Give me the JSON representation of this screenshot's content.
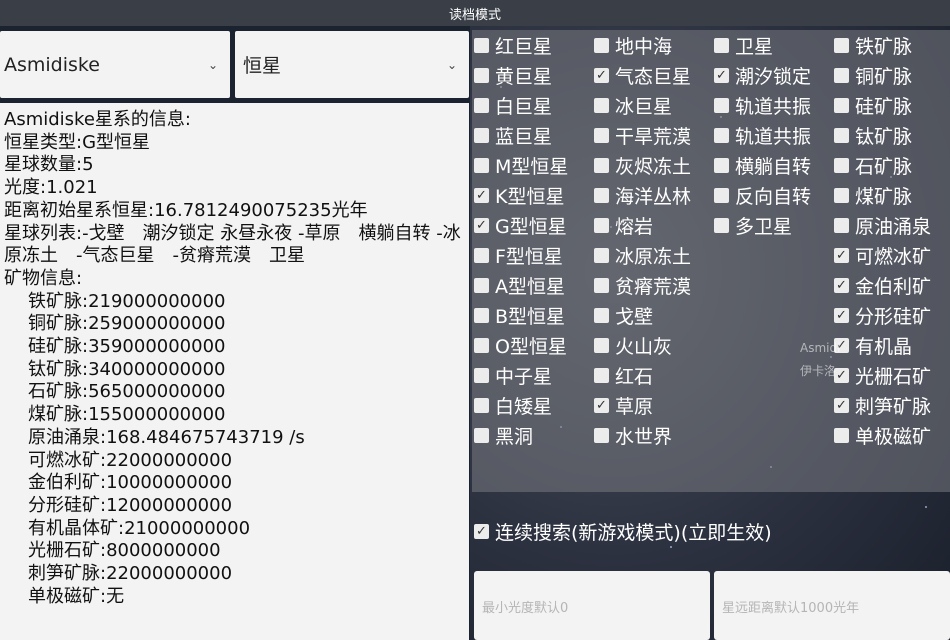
{
  "window": {
    "title": "读档模式"
  },
  "dropdowns": {
    "system": "Asmidiske",
    "star_type": "恒星"
  },
  "info": {
    "lines": [
      "Asmidiske星系的信息:",
      "恒星类型:G型恒星",
      "星球数量:5",
      "光度:1.021",
      "距离初始星系恒星:16.7812490075235光年",
      "星球列表:-戈壁　潮汐锁定 永昼永夜 -草原　横躺自转 -冰原冻土　-气态巨星　-贫瘠荒漠　卫星",
      "矿物信息:"
    ],
    "minerals": [
      "铁矿脉:219000000000",
      "铜矿脉:259000000000",
      "硅矿脉:359000000000",
      "钛矿脉:340000000000",
      "石矿脉:565000000000",
      "煤矿脉:155000000000",
      "原油涌泉:168.484675743719 /s",
      "可燃冰矿:22000000000",
      "金伯利矿:10000000000",
      "分形硅矿:12000000000",
      "有机晶体矿:21000000000",
      "光栅石矿:8000000000",
      "刺笋矿脉:22000000000",
      "单极磁矿:无"
    ]
  },
  "options": {
    "col1": [
      {
        "label": "红巨星",
        "checked": false
      },
      {
        "label": "黄巨星",
        "checked": false
      },
      {
        "label": "白巨星",
        "checked": false
      },
      {
        "label": "蓝巨星",
        "checked": false
      },
      {
        "label": "M型恒星",
        "checked": false
      },
      {
        "label": "K型恒星",
        "checked": true
      },
      {
        "label": "G型恒星",
        "checked": true
      },
      {
        "label": "F型恒星",
        "checked": false
      },
      {
        "label": "A型恒星",
        "checked": false
      },
      {
        "label": "B型恒星",
        "checked": false
      },
      {
        "label": "O型恒星",
        "checked": false
      },
      {
        "label": "中子星",
        "checked": false
      },
      {
        "label": "白矮星",
        "checked": false
      },
      {
        "label": "黑洞",
        "checked": false
      }
    ],
    "col2": [
      {
        "label": "地中海",
        "checked": false
      },
      {
        "label": "气态巨星",
        "checked": true
      },
      {
        "label": "冰巨星",
        "checked": false
      },
      {
        "label": "干旱荒漠",
        "checked": false
      },
      {
        "label": "灰烬冻土",
        "checked": false
      },
      {
        "label": "海洋丛林",
        "checked": false
      },
      {
        "label": "熔岩",
        "checked": false
      },
      {
        "label": "冰原冻土",
        "checked": false
      },
      {
        "label": "贫瘠荒漠",
        "checked": false
      },
      {
        "label": "戈壁",
        "checked": false
      },
      {
        "label": "火山灰",
        "checked": false
      },
      {
        "label": "红石",
        "checked": false
      },
      {
        "label": "草原",
        "checked": true
      },
      {
        "label": "水世界",
        "checked": false
      }
    ],
    "col3": [
      {
        "label": "卫星",
        "checked": false
      },
      {
        "label": "潮汐锁定",
        "checked": true
      },
      {
        "label": "轨道共振",
        "checked": false
      },
      {
        "label": "轨道共振",
        "checked": false
      },
      {
        "label": "横躺自转",
        "checked": false
      },
      {
        "label": "反向自转",
        "checked": false
      },
      {
        "label": "多卫星",
        "checked": false
      }
    ],
    "col4": [
      {
        "label": "铁矿脉",
        "checked": false
      },
      {
        "label": "铜矿脉",
        "checked": false
      },
      {
        "label": "硅矿脉",
        "checked": false
      },
      {
        "label": "钛矿脉",
        "checked": false
      },
      {
        "label": "石矿脉",
        "checked": false
      },
      {
        "label": "煤矿脉",
        "checked": false
      },
      {
        "label": "原油涌泉",
        "checked": false
      },
      {
        "label": "可燃冰矿",
        "checked": true
      },
      {
        "label": "金伯利矿",
        "checked": true
      },
      {
        "label": "分形硅矿",
        "checked": true
      },
      {
        "label": "有机晶",
        "checked": true
      },
      {
        "label": "光栅石矿",
        "checked": true
      },
      {
        "label": "刺笋矿脉",
        "checked": true
      },
      {
        "label": "单极磁矿",
        "checked": false
      }
    ]
  },
  "continuous_search": {
    "label": "连续搜索(新游戏模式)(立即生效)",
    "checked": true
  },
  "fields": {
    "min_luminosity_placeholder": "最小光度默认0",
    "max_distance_placeholder": "星远距离默认1000光年"
  },
  "background_text": [
    "Asmidi",
    "伊卡洛"
  ],
  "icons": {
    "chevron": "chevron-down-icon",
    "check": "checkmark-icon"
  }
}
